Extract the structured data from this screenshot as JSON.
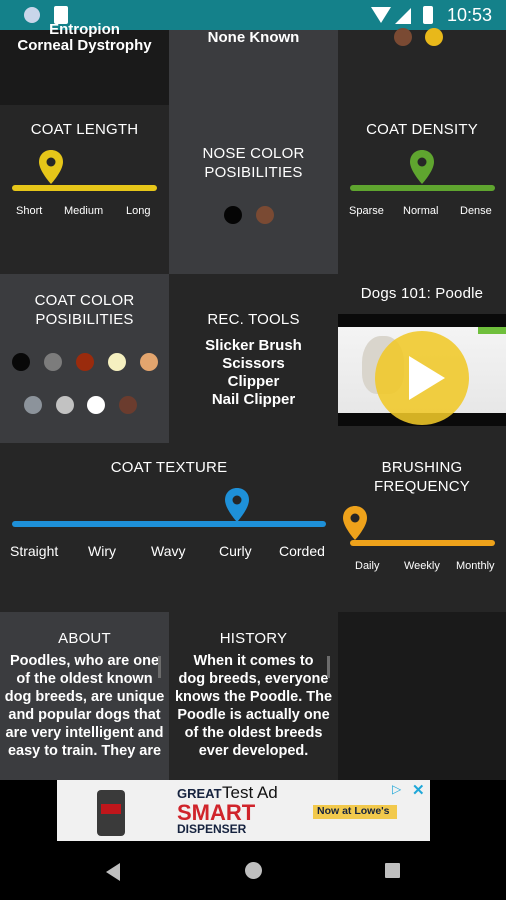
{
  "status_bar": {
    "time": "10:53"
  },
  "top_row": {
    "left_lines": [
      "Entropion",
      "Corneal Dystrophy"
    ],
    "middle_text": "None Known"
  },
  "coat_length": {
    "title": "COAT LENGTH",
    "labels": [
      "Short",
      "Medium",
      "Long"
    ],
    "level": 0.3,
    "color": "#e6c619"
  },
  "nose_color": {
    "title_line1": "NOSE COLOR",
    "title_line2": "POSIBILITIES",
    "colors": [
      "#050505",
      "#7a4a33"
    ]
  },
  "coat_density": {
    "title": "COAT DENSITY",
    "labels": [
      "Sparse",
      "Normal",
      "Dense"
    ],
    "level": 0.5,
    "color": "#5fa52f"
  },
  "coat_color": {
    "title_line1": "COAT COLOR",
    "title_line2": "POSIBILITIES",
    "colors_row1": [
      "#080808",
      "#7c7c7c",
      "#9a2b0d",
      "#f5f0c0",
      "#e3a56e"
    ],
    "colors_row2": [
      "#8c939b",
      "#c2c2c2",
      "#ffffff",
      "#6b3c2e"
    ]
  },
  "rec_tools": {
    "title": "REC. TOOLS",
    "items": [
      "Slicker Brush",
      "Scissors",
      "Clipper",
      "Nail Clipper"
    ]
  },
  "video": {
    "title": "Dogs 101: Poodle",
    "play_icon": "play-icon"
  },
  "coat_texture": {
    "title": "COAT TEXTURE",
    "labels": [
      "Straight",
      "Wiry",
      "Wavy",
      "Curly",
      "Corded"
    ],
    "level": 0.71,
    "color": "#1e90d8"
  },
  "brushing": {
    "title_line1": "BRUSHING",
    "title_line2": "FREQUENCY",
    "labels": [
      "Daily",
      "Weekly",
      "Monthly"
    ],
    "level": 0.0,
    "color": "#eea21b"
  },
  "about": {
    "title": "ABOUT",
    "lines": [
      "Poodles, who are one",
      "of the oldest known",
      "dog breeds, are unique",
      "and popular dogs that",
      "are very intelligent and",
      "easy to train. They are"
    ]
  },
  "history": {
    "title": "HISTORY",
    "lines": [
      "When it comes to",
      "dog breeds, everyone",
      "knows the Poodle. The",
      "Poodle is actually one",
      "of the oldest breeds",
      "ever developed."
    ]
  },
  "ad": {
    "label": "Test Ad",
    "line1": "GREAT",
    "line2": "SMART",
    "line3": "DISPENSER",
    "cta": "Now at Lowe's"
  }
}
